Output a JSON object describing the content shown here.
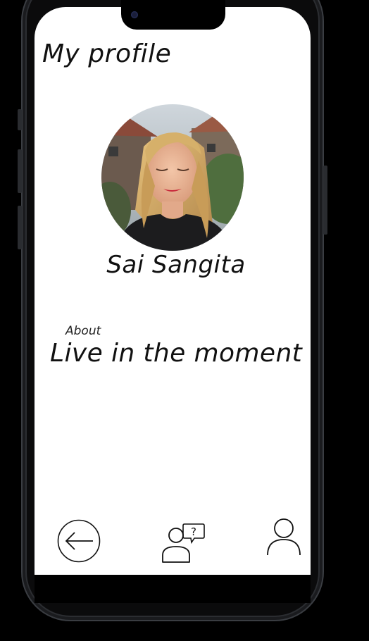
{
  "header": {
    "title": "My profile"
  },
  "profile": {
    "name": "Sai Sangita",
    "avatar_icon": "profile-photo",
    "about_label": "About",
    "about_text": "Live in the moment"
  },
  "bottom_nav": {
    "items": [
      {
        "icon": "back-arrow-icon"
      },
      {
        "icon": "user-help-icon"
      },
      {
        "icon": "user-profile-icon"
      }
    ]
  },
  "colors": {
    "background": "#000000",
    "screen": "#ffffff",
    "text": "#111111"
  }
}
